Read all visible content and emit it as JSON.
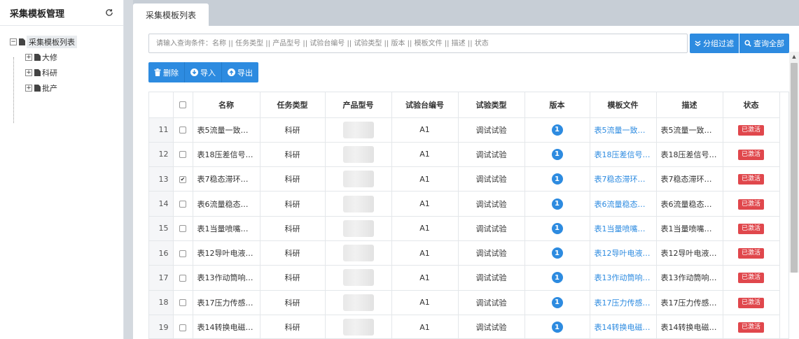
{
  "sidebar": {
    "title": "采集模板管理",
    "refresh_icon": "refresh-icon",
    "tree": {
      "root": {
        "toggle": "−",
        "label": "采集模板列表"
      },
      "children": [
        {
          "toggle": "+",
          "label": "大修"
        },
        {
          "toggle": "+",
          "label": "科研"
        },
        {
          "toggle": "+",
          "label": "批产"
        }
      ]
    }
  },
  "tabs": [
    {
      "label": "采集模板列表",
      "active": true
    }
  ],
  "search": {
    "placeholder": "请输入查询条件：名称 || 任务类型 || 产品型号 || 试验台编号 || 试验类型 || 版本 || 模板文件 || 描述 || 状态",
    "group_filter_label": "分组过滤",
    "query_all_label": "查询全部"
  },
  "toolbar": {
    "delete_label": "删除",
    "import_label": "导入",
    "export_label": "导出"
  },
  "table": {
    "headers": [
      "名称",
      "任务类型",
      "产品型号",
      "试验台编号",
      "试验类型",
      "版本",
      "模板文件",
      "描述",
      "状态"
    ],
    "rows": [
      {
        "idx": "11",
        "checked": false,
        "name": "表5流量一致…",
        "task_type": "科研",
        "station": "A1",
        "test_type": "调试试验",
        "version": "1",
        "template_file": "表5流量一致…",
        "desc": "表5流量一致…",
        "status": "已激活"
      },
      {
        "idx": "12",
        "checked": false,
        "name": "表18压差信号…",
        "task_type": "科研",
        "station": "A1",
        "test_type": "调试试验",
        "version": "1",
        "template_file": "表18压差信号…",
        "desc": "表18压差信号…",
        "status": "已激活"
      },
      {
        "idx": "13",
        "checked": true,
        "name": "表7稳态滞环…",
        "task_type": "科研",
        "station": "A1",
        "test_type": "调试试验",
        "version": "1",
        "template_file": "表7稳态滞环…",
        "desc": "表7稳态滞环…",
        "status": "已激活"
      },
      {
        "idx": "14",
        "checked": false,
        "name": "表6流量稳态…",
        "task_type": "科研",
        "station": "A1",
        "test_type": "调试试验",
        "version": "1",
        "template_file": "表6流量稳态…",
        "desc": "表6流量稳态…",
        "status": "已激活"
      },
      {
        "idx": "15",
        "checked": false,
        "name": "表1当量喷嘴…",
        "task_type": "科研",
        "station": "A1",
        "test_type": "调试试验",
        "version": "1",
        "template_file": "表1当量喷嘴…",
        "desc": "表1当量喷嘴…",
        "status": "已激活"
      },
      {
        "idx": "16",
        "checked": false,
        "name": "表12导叶电液…",
        "task_type": "科研",
        "station": "A1",
        "test_type": "调试试验",
        "version": "1",
        "template_file": "表12导叶电液…",
        "desc": "表12导叶电液…",
        "status": "已激活"
      },
      {
        "idx": "17",
        "checked": false,
        "name": "表13作动筒响…",
        "task_type": "科研",
        "station": "A1",
        "test_type": "调试试验",
        "version": "1",
        "template_file": "表13作动筒响…",
        "desc": "表13作动筒响…",
        "status": "已激活"
      },
      {
        "idx": "18",
        "checked": false,
        "name": "表17压力传感…",
        "task_type": "科研",
        "station": "A1",
        "test_type": "调试试验",
        "version": "1",
        "template_file": "表17压力传感…",
        "desc": "表17压力传感…",
        "status": "已激活"
      },
      {
        "idx": "19",
        "checked": false,
        "name": "表14转换电磁…",
        "task_type": "科研",
        "station": "A1",
        "test_type": "调试试验",
        "version": "1",
        "template_file": "表14转换电磁…",
        "desc": "表14转换电磁…",
        "status": "已激活"
      }
    ]
  },
  "icons": {
    "delete": "trash-icon",
    "import": "download-circle-icon",
    "export": "upload-circle-icon",
    "group_filter": "double-chevron-down-icon",
    "query_all": "search-icon"
  },
  "colors": {
    "accent": "#2d8be0",
    "status_active": "#e0474c",
    "background": "#d4d9df"
  }
}
